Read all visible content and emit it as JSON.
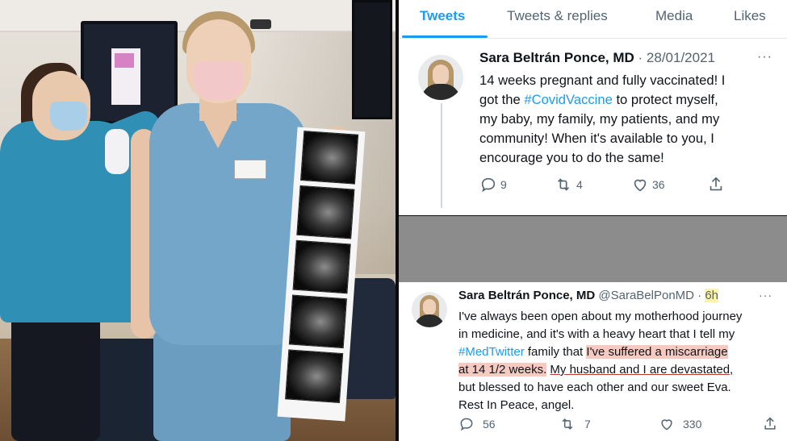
{
  "tabs": [
    {
      "label": "Tweets"
    },
    {
      "label": "Tweets & replies"
    },
    {
      "label": "Media"
    },
    {
      "label": "Likes"
    }
  ],
  "tweet1": {
    "name": "Sara Beltrán Ponce, MD",
    "separator": "·",
    "date": "28/01/2021",
    "more": "···",
    "text": {
      "line1": "14 weeks pregnant and fully vaccinated! I",
      "line2_pre": "got the ",
      "hashtag": "#CovidVaccine",
      "line2_post": " to protect myself,",
      "line3": "my baby, my family, my patients, and my",
      "line4": "community! When it's available to you, I",
      "line5": "encourage you to do the same!"
    },
    "replies": "9",
    "retweets": "4",
    "likes": "36"
  },
  "tweet2": {
    "name": "Sara Beltrán Ponce, MD",
    "handle": "@SaraBelPonMD",
    "separator": "·",
    "time": "6h",
    "more": "···",
    "text": {
      "line1": "I've always been open about my motherhood journey",
      "line2": "in medicine, and it's with a heavy heart that I tell my",
      "hashtag": "#MedTwitter",
      "line3_mid": " family that ",
      "highlight1": "I've suffered a miscarriage",
      "highlight2": "at 14 1/2 weeks.",
      "line4_space": " ",
      "underline": "My husband and I are devastated,",
      "line5": "but blessed to have each other and our sweet Eva.",
      "line6": "Rest In Peace, angel."
    },
    "replies": "56",
    "retweets": "7",
    "likes": "330"
  },
  "colors": {
    "accent": "#1d9bf0",
    "muted": "#536471",
    "highlight": "#f6c9c1",
    "time_highlight": "#fff3a8"
  },
  "icons": [
    "reply-icon",
    "retweet-icon",
    "like-icon",
    "share-icon"
  ]
}
